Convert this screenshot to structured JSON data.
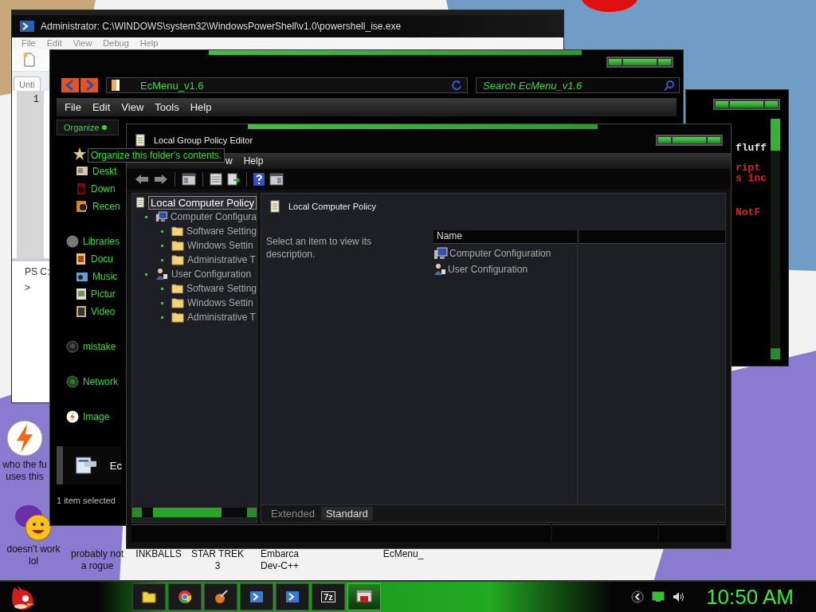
{
  "powershell_window": {
    "title": "Administrator: C:\\WINDOWS\\system32\\WindowsPowerShell\\v1.0\\powershell_ise.exe",
    "menu": [
      {
        "label": "File",
        "disabled": true
      },
      {
        "label": "Edit",
        "disabled": true
      },
      {
        "label": "View",
        "disabled": true
      },
      {
        "label": "Debug",
        "disabled": true
      },
      {
        "label": "Help",
        "disabled": true
      }
    ],
    "tab": "Unti",
    "line_number": "1",
    "console_prompt": "PS C:",
    "console_input": ">"
  },
  "console_window": {
    "lines": [
      {
        "text": "fluff",
        "color": "#e8e8e8"
      },
      {
        "text": "ript",
        "color": "#e02020"
      },
      {
        "text": "s inc",
        "color": "#e02020"
      },
      {
        "text": "NotF",
        "color": "#e02020"
      }
    ]
  },
  "explorer_window": {
    "address": "EcMenu_v1.6",
    "search": {
      "placeholder": "Search EcMenu_v1.6"
    },
    "menu": [
      "File",
      "Edit",
      "View",
      "Tools",
      "Help"
    ],
    "organize_button": "Organize",
    "nav_groups": [
      {
        "kind": "favorites",
        "items": [
          {
            "label": "Deskt",
            "kind": "desktop"
          },
          {
            "label": "Down",
            "kind": "downloads"
          },
          {
            "label": "Recen",
            "kind": "recent"
          }
        ]
      },
      {
        "kind": "libraries",
        "label": "Libraries",
        "items": [
          {
            "label": "Docu",
            "kind": "documents"
          },
          {
            "label": "Music",
            "kind": "music"
          },
          {
            "label": "Pictur",
            "kind": "pictures"
          },
          {
            "label": "Video",
            "kind": "videos"
          }
        ]
      },
      {
        "kind": "homegroup",
        "label": "mistake"
      },
      {
        "kind": "network",
        "label": "Network"
      },
      {
        "kind": "app",
        "label": "Image"
      }
    ],
    "selected_file": {
      "label": "Ec",
      "selected": true
    },
    "status": "1 item selected"
  },
  "tooltip": "Organize this folder's contents.",
  "policy_editor": {
    "title": "Local Group Policy Editor",
    "menu": [
      "w",
      "Help"
    ],
    "tree": [
      {
        "label": "Local Computer Policy",
        "kind": "policy",
        "selected": true,
        "children": [
          {
            "label": "Computer Configura",
            "kind": "computer",
            "selected": false,
            "children": [
              {
                "label": "Software Setting",
                "kind": "folder",
                "selected": false
              },
              {
                "label": "Windows Settin",
                "kind": "folder",
                "selected": false
              },
              {
                "label": "Administrative T",
                "kind": "folder",
                "selected": false
              }
            ]
          },
          {
            "label": "User Configuration",
            "kind": "users",
            "selected": false,
            "children": [
              {
                "label": "Software Setting",
                "kind": "folder",
                "selected": false
              },
              {
                "label": "Windows Settin",
                "kind": "folder",
                "selected": false
              },
              {
                "label": "Administrative T",
                "kind": "folder",
                "selected": false
              }
            ]
          }
        ]
      }
    ],
    "header": "Local Computer Policy",
    "description": "Select an item to view its description.",
    "columns": [
      "Name"
    ],
    "items": [
      {
        "label": "Computer Configuration",
        "kind": "computer"
      },
      {
        "label": "User Configuration",
        "kind": "users"
      }
    ],
    "tabs": [
      {
        "label": "Extended",
        "selected": false
      },
      {
        "label": "Standard",
        "selected": true
      }
    ]
  },
  "desktop_icons": [
    {
      "label": "who the fu\nuses this",
      "kind": "bolt"
    },
    {
      "label": "doesn't work\nlol",
      "kind": "messenger"
    },
    {
      "label": "probably not\na rogue",
      "kind": "none"
    },
    {
      "label": "INKBALLS",
      "kind": "none"
    },
    {
      "label": "STAR TREK\n3",
      "kind": "none"
    },
    {
      "label": "Embarca\nDev-C++",
      "kind": "none"
    },
    {
      "label": "EcMenu_",
      "kind": "none"
    }
  ],
  "taskbar": {
    "buttons": [
      {
        "kind": "folder",
        "selected": false
      },
      {
        "kind": "browser",
        "selected": false
      },
      {
        "kind": "paint",
        "selected": false
      },
      {
        "kind": "shell",
        "selected": false
      },
      {
        "kind": "shell",
        "selected": false
      },
      {
        "kind": "archive",
        "text": "7z",
        "selected": false
      },
      {
        "kind": "policy",
        "selected": true
      }
    ],
    "clock": "10:50 AM"
  }
}
